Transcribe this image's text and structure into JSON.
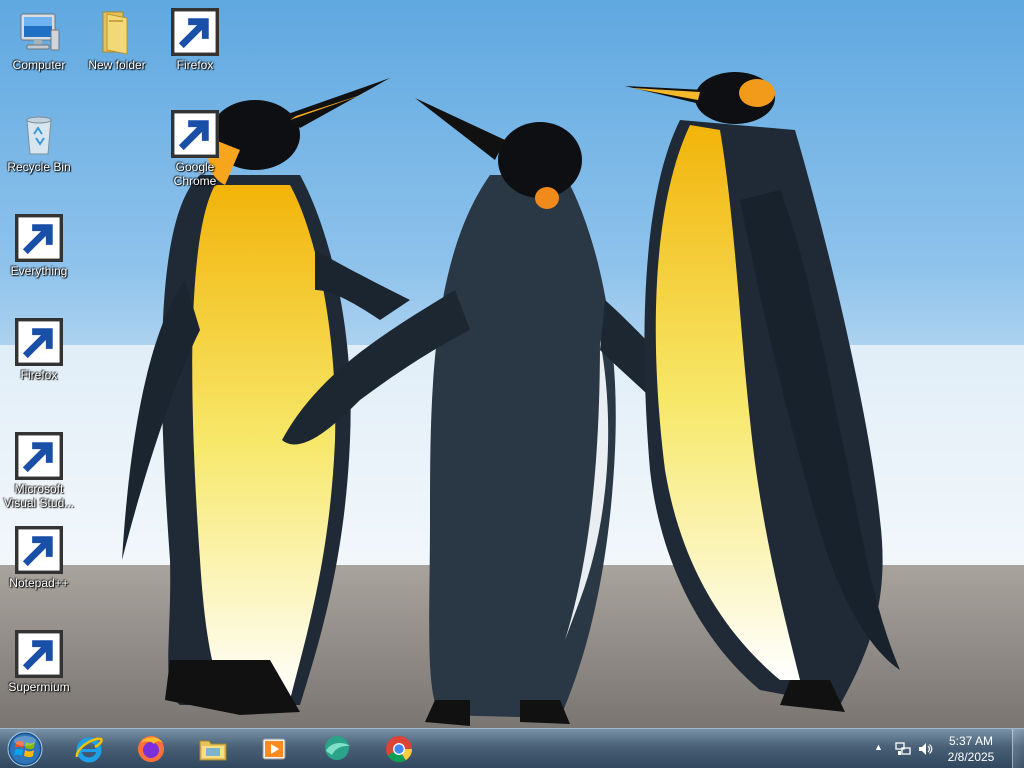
{
  "desktop": {
    "icons": [
      {
        "name": "Computer",
        "label": "Computer"
      },
      {
        "name": "New folder",
        "label": "New folder"
      },
      {
        "name": "Firefox",
        "label": "Firefox"
      },
      {
        "name": "Recycle Bin",
        "label": "Recycle Bin"
      },
      {
        "name": "Google Chrome",
        "label": "Google Chrome"
      },
      {
        "name": "Everything",
        "label": "Everything"
      },
      {
        "name": "Firefox",
        "label": "Firefox"
      },
      {
        "name": "Microsoft Visual Studio",
        "label": "Microsoft Visual Stud..."
      },
      {
        "name": "Notepad++",
        "label": "Notepad++"
      },
      {
        "name": "Supermium",
        "label": "Supermium"
      }
    ]
  },
  "taskbar": {
    "pinned": [
      {
        "name": "internet-explorer-icon"
      },
      {
        "name": "firefox-icon"
      },
      {
        "name": "file-explorer-icon"
      },
      {
        "name": "media-player-icon"
      },
      {
        "name": "supermium-icon"
      },
      {
        "name": "chrome-icon"
      }
    ],
    "tray": {
      "overflow_glyph": "▲",
      "time": "5:37 AM",
      "date": "2/8/2025"
    }
  },
  "colors": {
    "taskbar": "#4a6a88",
    "sky": "#8fc3ec",
    "sand": "#8a8580"
  }
}
